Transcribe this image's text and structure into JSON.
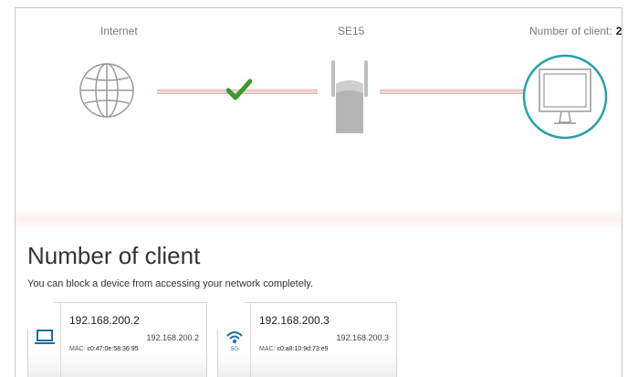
{
  "topology": {
    "internet_label": "Internet",
    "device_label": "SE15",
    "clients_label": "Number of client:",
    "clients_count": "2"
  },
  "section": {
    "title": "Number of client",
    "description": "You can block a device from accessing your network completely."
  },
  "clients": [
    {
      "ip": "192.168.200.2",
      "ip_secondary": "192.168.200.2",
      "mac_label": "MAC:",
      "mac": "c0:47:0e:58:36:95",
      "connection": "wired",
      "icon": "laptop-icon"
    },
    {
      "ip": "192.168.200.3",
      "ip_secondary": "192.168.200.3",
      "mac_label": "MAC:",
      "mac": "c0:a8:10:9d:73:e9",
      "connection": "wifi-5g",
      "icon": "wifi-5g-icon",
      "band_label": "5G"
    }
  ],
  "colors": {
    "accent": "#2aa0a8",
    "check": "#3a9a2a",
    "link_line": "#f3d4d7"
  }
}
